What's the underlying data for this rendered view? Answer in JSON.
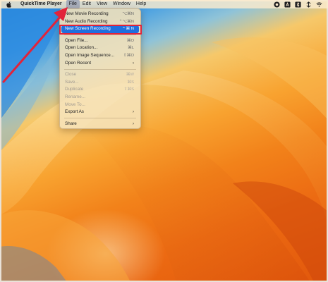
{
  "colors": {
    "accent": "#1f6fde",
    "annotation": "#e2233a",
    "menubar": "#fcecd0"
  },
  "menubar": {
    "apple_icon": "apple-icon",
    "app_name": "QuickTime Player",
    "menus": [
      "File",
      "Edit",
      "View",
      "Window",
      "Help"
    ],
    "active_menu": "File",
    "status_icons": [
      "record-icon",
      "text-input-icon",
      "bluetooth-icon",
      "network-icon",
      "wifi-icon"
    ]
  },
  "file_menu": {
    "new_movie": {
      "label": "New Movie Recording",
      "shortcut": "⌥⌘N"
    },
    "new_audio": {
      "label": "New Audio Recording",
      "shortcut": "⌃⌥⌘N"
    },
    "new_screen": {
      "label": "New Screen Recording",
      "shortcut": "^ ⌘ N"
    },
    "open_file": {
      "label": "Open File...",
      "shortcut": "⌘O"
    },
    "open_location": {
      "label": "Open Location...",
      "shortcut": "⌘L"
    },
    "open_image_sequence": {
      "label": "Open Image Sequence...",
      "shortcut": "⇧⌘O"
    },
    "open_recent": {
      "label": "Open Recent"
    },
    "close": {
      "label": "Close",
      "shortcut": "⌘W"
    },
    "save": {
      "label": "Save...",
      "shortcut": "⌘S"
    },
    "duplicate": {
      "label": "Duplicate",
      "shortcut": "⇧⌘S"
    },
    "rename": {
      "label": "Rename..."
    },
    "move_to": {
      "label": "Move To..."
    },
    "export_as": {
      "label": "Export As"
    },
    "share": {
      "label": "Share"
    },
    "submenu_chevron": "›"
  }
}
